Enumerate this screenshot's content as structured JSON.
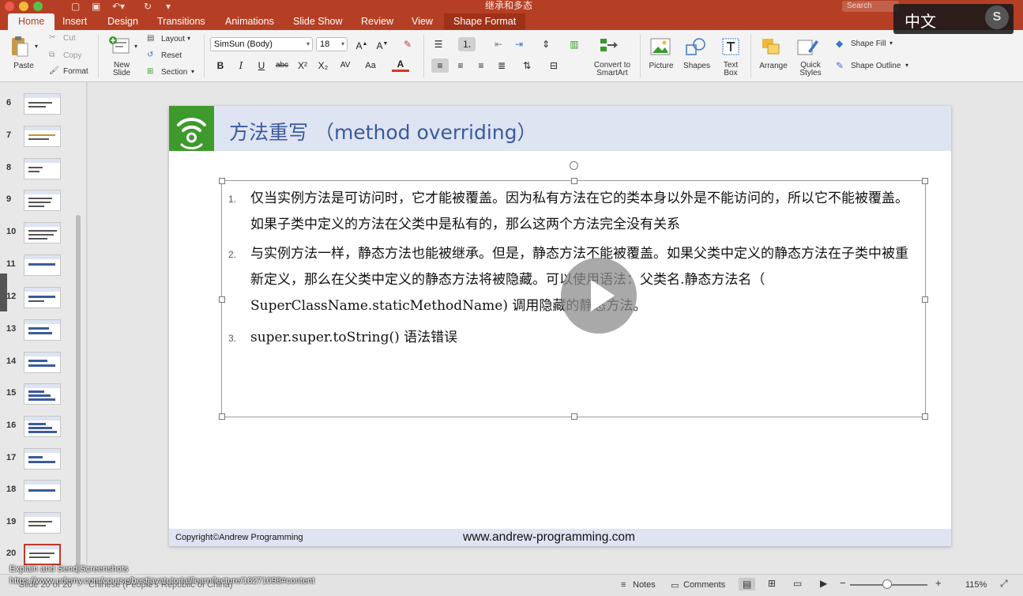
{
  "window": {
    "doc_title": "继承和多态",
    "search_placeholder": "Search"
  },
  "tabs": [
    {
      "label": "Home",
      "active": true
    },
    {
      "label": "Insert"
    },
    {
      "label": "Design"
    },
    {
      "label": "Transitions"
    },
    {
      "label": "Animations"
    },
    {
      "label": "Slide Show"
    },
    {
      "label": "Review"
    },
    {
      "label": "View"
    },
    {
      "label": "Shape Format"
    }
  ],
  "ribbon": {
    "clipboard": {
      "paste": "Paste",
      "cut": "Cut",
      "copy": "Copy",
      "format": "Format"
    },
    "slides": {
      "new_slide": "New\nSlide",
      "layout": "Layout",
      "reset": "Reset",
      "section": "Section"
    },
    "font": {
      "name": "SimSun (Body)",
      "size": "18",
      "bold": "B",
      "italic": "I",
      "underline": "U",
      "strike": "abc",
      "superscript": "X²",
      "subscript": "X₂",
      "spacing": "AV",
      "case": "Aa",
      "color": "A"
    },
    "insert": {
      "convert_smartart": "Convert to\nSmartArt",
      "picture": "Picture",
      "shapes": "Shapes",
      "text_box": "Text\nBox"
    },
    "drawing": {
      "arrange": "Arrange",
      "quick_styles": "Quick\nStyles",
      "shape_fill": "Shape Fill",
      "shape_outline": "Shape Outline"
    }
  },
  "overlay": {
    "language": "中文",
    "logo_letter": "S"
  },
  "thumbnails": [
    {
      "num": "6"
    },
    {
      "num": "7"
    },
    {
      "num": "8"
    },
    {
      "num": "9"
    },
    {
      "num": "10"
    },
    {
      "num": "11"
    },
    {
      "num": "12"
    },
    {
      "num": "13"
    },
    {
      "num": "14"
    },
    {
      "num": "15"
    },
    {
      "num": "16"
    },
    {
      "num": "17"
    },
    {
      "num": "18"
    },
    {
      "num": "19"
    },
    {
      "num": "20",
      "selected": true
    }
  ],
  "slide": {
    "title": "方法重写 （method overriding）",
    "points": [
      {
        "num": "1.",
        "text": "仅当实例方法是可访问时，它才能被覆盖。因为私有方法在它的类本身以外是不能访问的，所以它不能被覆盖。如果子类中定义的方法在父类中是私有的，那么这两个方法完全没有关系"
      },
      {
        "num": "2.",
        "text": "与实例方法一样，静态方法也能被继承。但是，静态方法不能被覆盖。如果父类中定义的静态方法在子类中被重新定义，那么在父类中定义的静态方法将被隐藏。可以使用语法：父类名.静态方法名（ SuperClassName.staticMethodName) 调用隐藏的静态方法。"
      },
      {
        "num": "3.",
        "text": "super.super.toString() 语法错误"
      }
    ],
    "copyright": "Copyright©Andrew Programming",
    "website": "www.andrew-programming.com"
  },
  "status": {
    "slide_info": "Slide 20 of 20",
    "language": "Chinese (People's Republic of China)",
    "notes": "Notes",
    "comments": "Comments",
    "zoom": "115%"
  },
  "overlay_text": {
    "line1": "Explain and Send Screenshots",
    "line2": "https://www.udemy.com/course/bestjavatutorial/learn/lecture/18271098#content"
  }
}
